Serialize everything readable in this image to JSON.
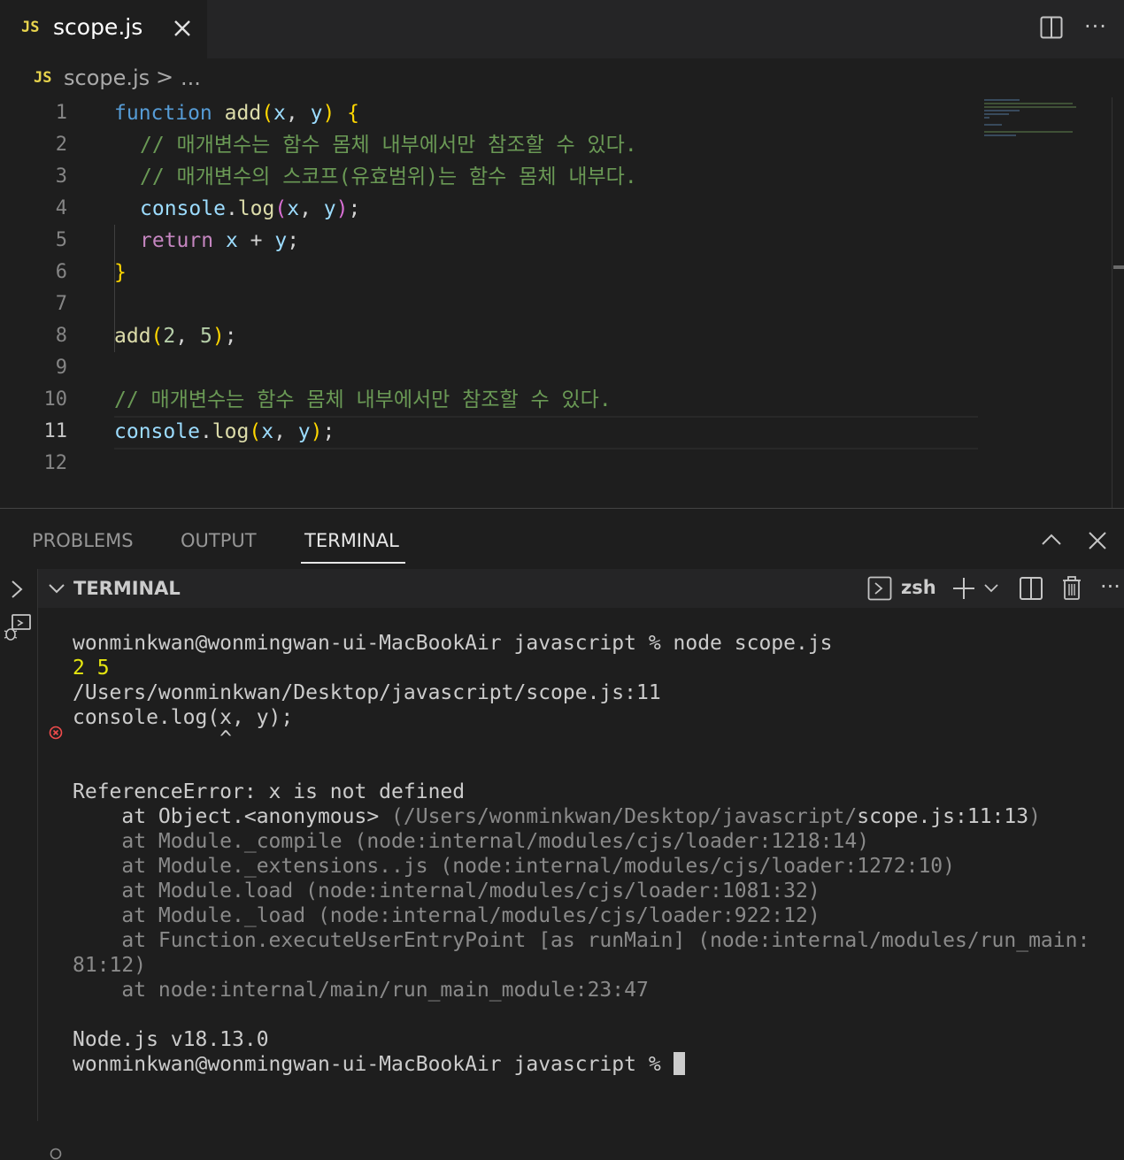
{
  "tab": {
    "badge": "JS",
    "label": "scope.js"
  },
  "breadcrumb": {
    "badge": "JS",
    "file": "scope.js",
    "separator": ">",
    "more": "..."
  },
  "editor": {
    "line_numbers": [
      "1",
      "2",
      "3",
      "4",
      "5",
      "6",
      "7",
      "8",
      "9",
      "10",
      "11",
      "12"
    ],
    "active_line": "11",
    "code": {
      "l1": {
        "kw": "function",
        "name": "add",
        "open": "(",
        "p1": "x",
        "comma": ", ",
        "p2": "y",
        "close": ")",
        "brace": " {"
      },
      "l2": "// 매개변수는 함수 몸체 내부에서만 참조할 수 있다.",
      "l3": "// 매개변수의 스코프(유효범위)는 함수 몸체 내부다.",
      "l4": {
        "obj": "console",
        "dot": ".",
        "method": "log",
        "open": "(",
        "a1": "x",
        "comma": ", ",
        "a2": "y",
        "close": ")",
        "semi": ";"
      },
      "l5": {
        "kw": "return",
        "a": " x",
        "op": " + ",
        "b": "y",
        "semi": ";"
      },
      "l6": "}",
      "l8": {
        "name": "add",
        "open": "(",
        "n1": "2",
        "comma": ", ",
        "n2": "5",
        "close": ")",
        "semi": ";"
      },
      "l10": "// 매개변수는 함수 몸체 내부에서만 참조할 수 있다.",
      "l11": {
        "obj": "console",
        "dot": ".",
        "method": "log",
        "open": "(",
        "a1": "x",
        "comma": ", ",
        "a2": "y",
        "close": ")",
        "semi": ";"
      }
    }
  },
  "panel": {
    "tabs": [
      "PROBLEMS",
      "OUTPUT",
      "TERMINAL"
    ],
    "active_tab": "TERMINAL",
    "terminal_title": "TERMINAL",
    "shell": "zsh"
  },
  "terminal": {
    "prompt1": "wonminkwan@wonmingwan-ui-MacBookAir javascript % node scope.js",
    "out1": "2 5",
    "out2": "/Users/wonminkwan/Desktop/javascript/scope.js:11",
    "out3": "console.log(x, y);",
    "out4": "            ^",
    "err": "ReferenceError: x is not defined",
    "st1_pre": "    at Object.<anonymous> ",
    "st1_path": "(/Users/wonminkwan/Desktop/javascript/",
    "st1_file": "scope.js:11:13",
    "st1_end": ")",
    "st2": "    at Module._compile (node:internal/modules/cjs/loader:1218:14)",
    "st3": "    at Module._extensions..js (node:internal/modules/cjs/loader:1272:10)",
    "st4": "    at Module.load (node:internal/modules/cjs/loader:1081:32)",
    "st5": "    at Module._load (node:internal/modules/cjs/loader:922:12)",
    "st6a": "    at Function.executeUserEntryPoint [as runMain] (node:internal/modules/run_main:",
    "st6b": "81:12)",
    "st7": "    at node:internal/main/run_main_module:23:47",
    "version": "Node.js v18.13.0",
    "prompt2": "wonminkwan@wonmingwan-ui-MacBookAir javascript % "
  },
  "colors": {
    "keyword": "#569cd6",
    "control": "#c586c0",
    "function": "#dcdcaa",
    "variable": "#9cdcfe",
    "number": "#b5cea8",
    "comment": "#6a9955",
    "error": "#f14c4c",
    "yellow": "#e5e510"
  },
  "icons": [
    "js-file-icon",
    "close-icon",
    "split-editor-icon",
    "more-actions-icon",
    "chevron-right-icon",
    "chevron-up-icon",
    "chevron-down-icon",
    "terminal-icon",
    "plus-icon",
    "trash-icon",
    "error-circle-icon",
    "debug-icon"
  ]
}
